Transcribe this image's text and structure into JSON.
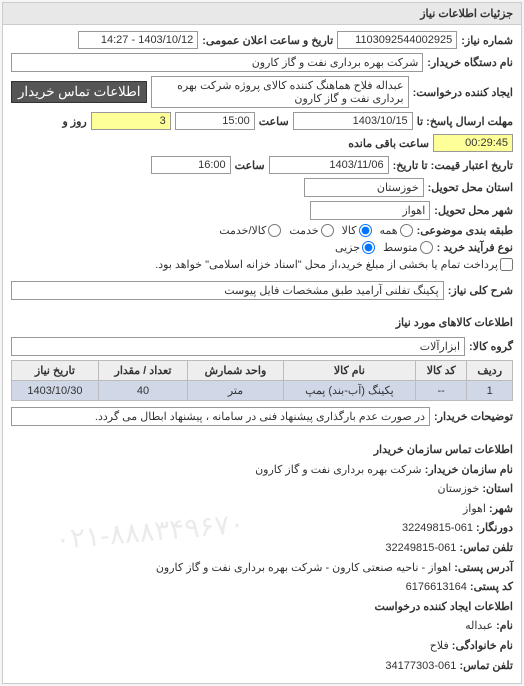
{
  "header": {
    "title": "جزئیات اطلاعات نیاز"
  },
  "fields": {
    "need_no_label": "شماره نیاز:",
    "need_no": "1103092544002925",
    "announce_label": "تاریخ و ساعت اعلان عمومی:",
    "announce_value": "1403/10/12 - 14:27",
    "buyer_org_label": "نام دستگاه خریدار:",
    "buyer_org": "شرکت بهره برداری نفت و گاز کارون",
    "requester_label": "ایجاد کننده درخواست:",
    "requester": "عبداله فلاح هماهنگ کننده کالای پروژه شرکت بهره برداری نفت و گاز کارون",
    "contact_btn": "اطلاعات تماس خریدار",
    "reply_deadline_label": "مهلت ارسال پاسخ: تا",
    "reply_date": "1403/10/15",
    "hour_label": "ساعت",
    "reply_time": "15:00",
    "day_label": "روز و",
    "days_left": "3",
    "remain_label": "ساعت باقی مانده",
    "remain_time": "00:29:45",
    "validity_label": "تاریخ اعتبار قیمت: تا تاریخ:",
    "validity_date": "1403/11/06",
    "validity_time": "16:00",
    "province_label": "استان محل تحویل:",
    "province": "خوزستان",
    "city_label": "شهر محل تحویل:",
    "city": "اهواز",
    "subject_group_label": "طبقه بندی موضوعی:",
    "rb_all": "همه",
    "rb_goods": "کالا",
    "rb_service": "خدمت",
    "rb_goods_service": "کالا/خدمت",
    "purchase_type_label": "نوع فرآیند خرید :",
    "rb_medium": "متوسط",
    "rb_minor": "جزیی",
    "purchase_note": "پرداخت تمام یا بخشی از مبلغ خرید،از محل \"اسناد خزانه اسلامی\" خواهد بود.",
    "spec_label": "شرح کلی نیاز:",
    "spec_value": "پکینگ تفلنی آرامید طبق مشخصات فایل پیوست",
    "goods_section": "اطلاعات کالاهای مورد نیاز",
    "goods_group_label": "گروه کالا:",
    "goods_group": "ابزارآلات",
    "remarks_label": "توضیحات خریدار:",
    "remarks_value": "در صورت عدم بارگذاری پیشنهاد فنی در سامانه ، پیشنهاد ابطال می گردد."
  },
  "table": {
    "headers": [
      "ردیف",
      "کد کالا",
      "نام کالا",
      "واحد شمارش",
      "تعداد / مقدار",
      "تاریخ نیاز"
    ],
    "row": {
      "idx": "1",
      "code": "--",
      "name": "پکینگ (آب-بند) پمپ",
      "unit": "متر",
      "qty": "40",
      "date": "1403/10/30"
    }
  },
  "contact": {
    "title": "اطلاعات تماس سازمان خریدار",
    "org_label": "نام سازمان خریدار:",
    "org": "شرکت بهره برداری نفت و گاز کارون",
    "province_label": "استان:",
    "province": "خوزستان",
    "city_label": "شهر:",
    "city": "اهواز",
    "precode_label": "دورنگار:",
    "precode": "061-32249815",
    "phone_label": "تلفن تماس:",
    "phone": "061-32249815",
    "address_label": "آدرس پستی:",
    "address": "اهواز - ناحیه صنعتی کارون - شرکت بهره برداری نفت و گاز کارون",
    "postal_label": "کد پستی:",
    "postal": "6176613164",
    "requester_title": "اطلاعات ایجاد کننده درخواست",
    "name_label": "نام:",
    "name": "عبداله",
    "lastname_label": "نام خانوادگی:",
    "lastname": "فلاح",
    "phone2_label": "تلفن تماس:",
    "phone2": "061-34177303",
    "watermark": "۰۲۱-۸۸۸۳۴۹۶۷۰"
  }
}
